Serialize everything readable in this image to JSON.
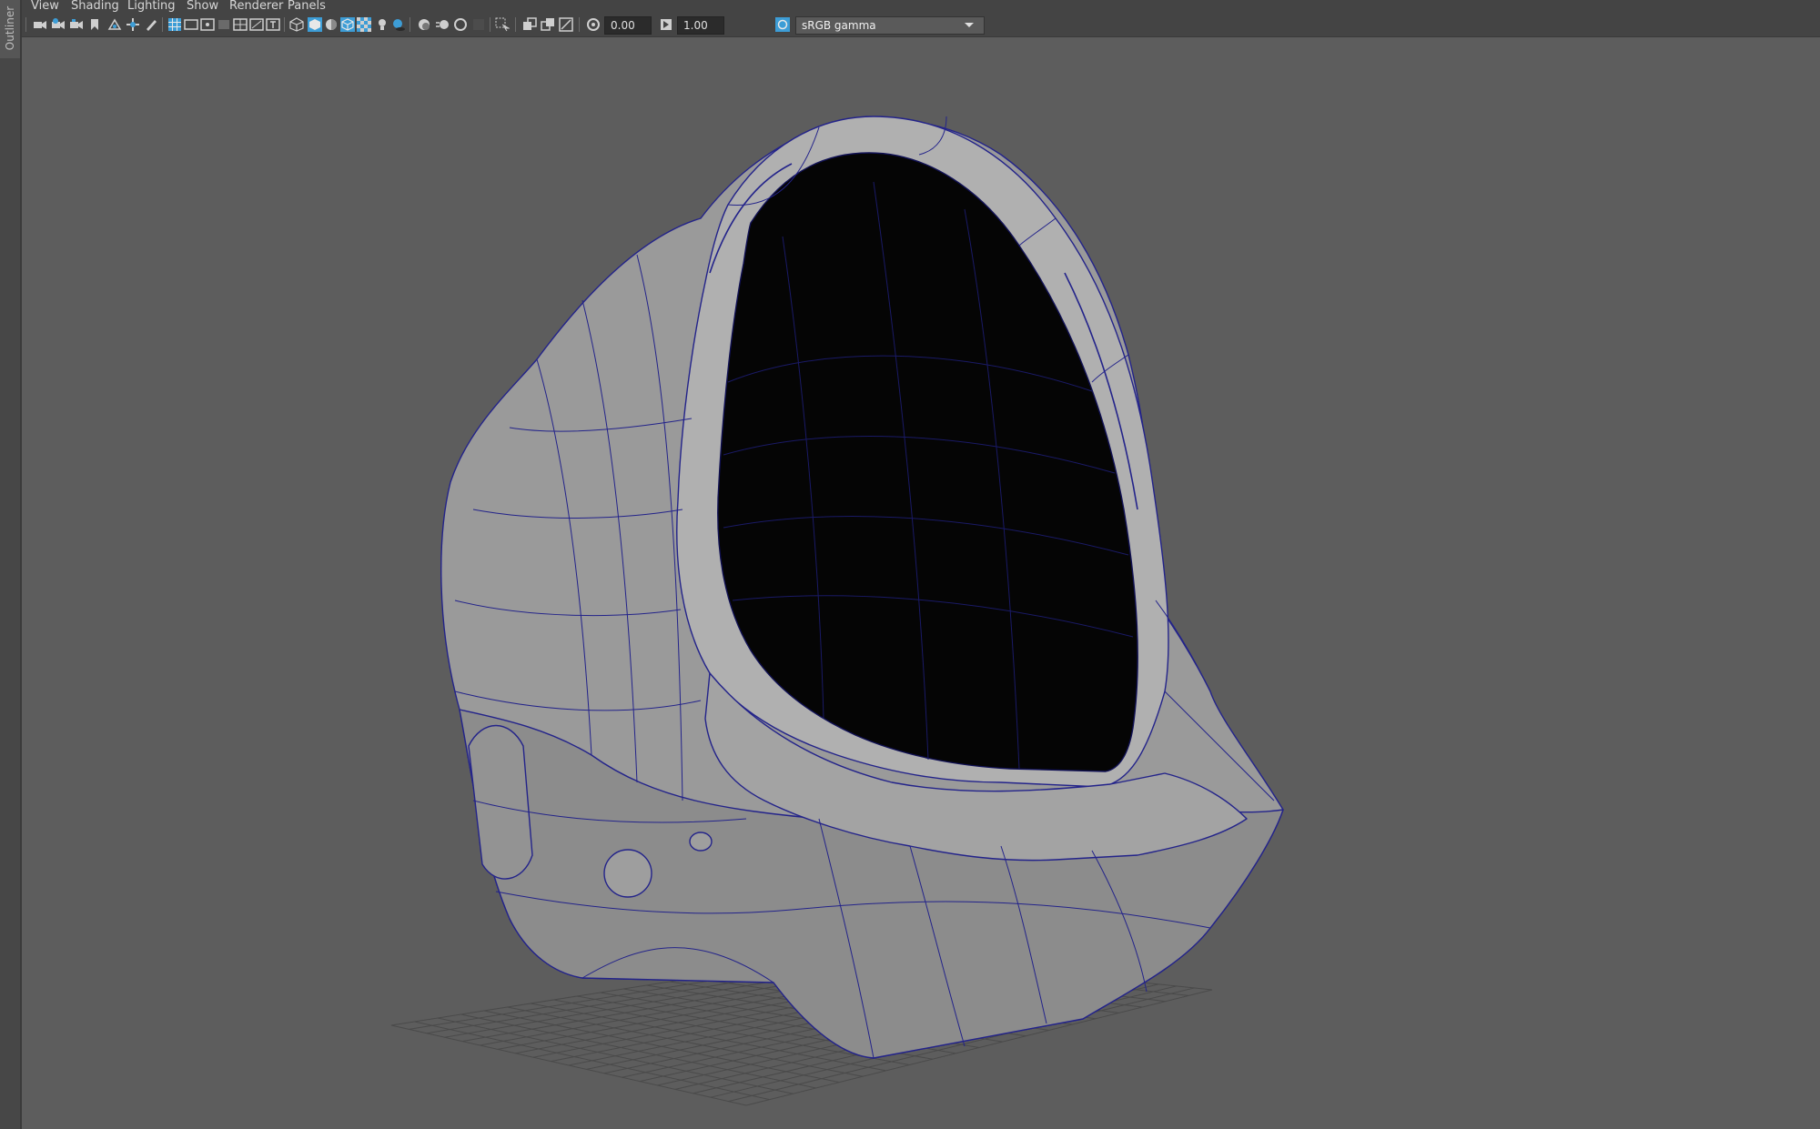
{
  "panel": {
    "outliner_label": "Outliner"
  },
  "menu": [
    "View",
    "Shading",
    "Lighting",
    "Show",
    "Renderer",
    "Panels"
  ],
  "toolbar": {
    "exposure_value": "0.00",
    "gamma_value": "1.00",
    "color_space": "sRGB gamma"
  },
  "colors": {
    "viewport_bg": "#5d5d5d",
    "wire": "#23238a",
    "shell": "#9c9c9c",
    "visor": "#050505",
    "toolbar_bg": "#444444",
    "icon_blue": "#3d9dd6"
  }
}
